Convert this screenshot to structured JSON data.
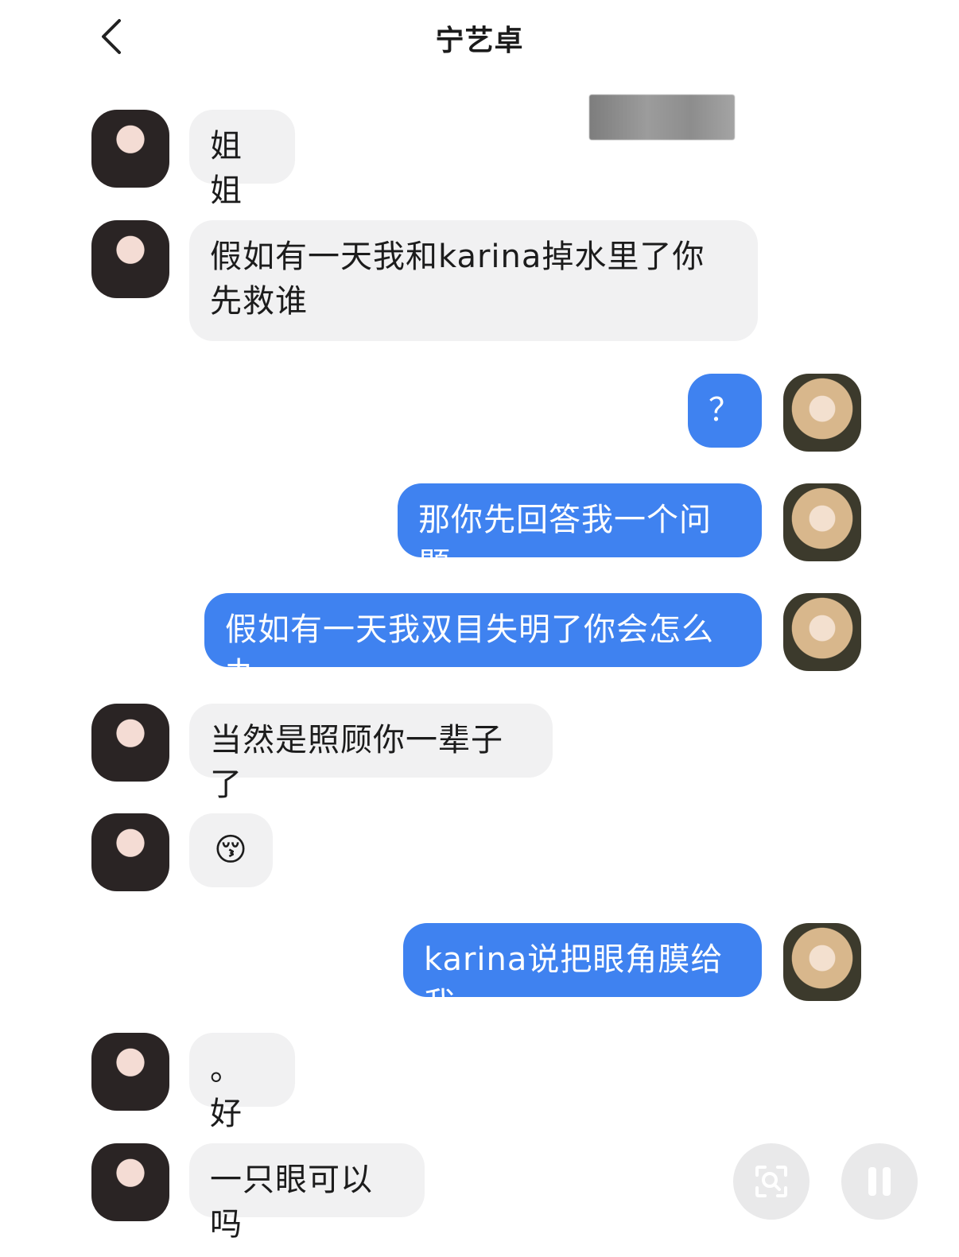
{
  "header": {
    "title": "宁艺卓",
    "back_icon": "chevron-left-icon"
  },
  "messages": [
    {
      "side": "in",
      "text": "姐姐"
    },
    {
      "side": "in",
      "text": "假如有一天我和karina掉水里了你先救谁"
    },
    {
      "side": "out",
      "text": "？"
    },
    {
      "side": "out",
      "text": "那你先回答我一个问题"
    },
    {
      "side": "out",
      "text": "假如有一天我双目失明了你会怎么办"
    },
    {
      "side": "in",
      "text": "当然是照顾你一辈子了"
    },
    {
      "side": "in",
      "text": "😚"
    },
    {
      "side": "out",
      "text": "karina说把眼角膜给我"
    },
    {
      "side": "in",
      "text": "。好"
    },
    {
      "side": "in",
      "text": "一只眼可以吗"
    }
  ],
  "controls": {
    "scan_icon": "scan-search-icon",
    "pause_icon": "pause-icon"
  },
  "colors": {
    "outgoing_bubble": "#3f82f0",
    "incoming_bubble": "#f1f1f2"
  }
}
